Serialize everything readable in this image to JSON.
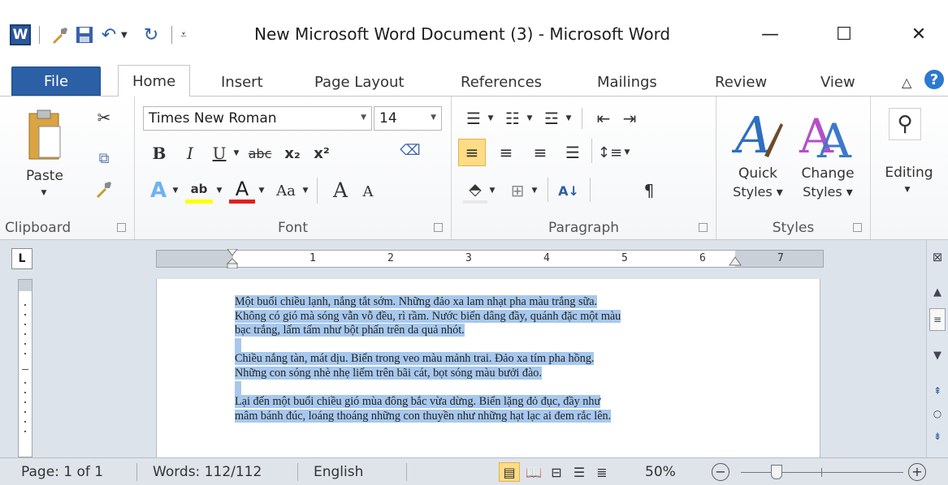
{
  "window": {
    "title": "New Microsoft Word Document (3)  -  Microsoft Word",
    "app_logo": "W",
    "minimize_icon": "—",
    "maximize_icon": "☐",
    "close_icon": "✕"
  },
  "qat": {
    "icons": [
      "brush-icon",
      "save-icon",
      "undo-icon",
      "redo-icon",
      "customize-icon"
    ]
  },
  "tabs": [
    "File",
    "Home",
    "Insert",
    "Page Layout",
    "References",
    "Mailings",
    "Review",
    "View"
  ],
  "ribbon": {
    "clipboard": {
      "label": "Clipboard",
      "paste_label": "Paste"
    },
    "font": {
      "label": "Font",
      "font_name": "Times New Roman",
      "font_size": "14",
      "bold": "B",
      "italic": "I",
      "underline": "U",
      "strike": "abc",
      "subscript": "x₂",
      "superscript": "x²",
      "change_case": "Aa",
      "grow": "A",
      "shrink": "A",
      "font_color": "A",
      "highlight": "ab"
    },
    "paragraph": {
      "label": "Paragraph",
      "pilcrow": "¶",
      "sort": "A↓"
    },
    "styles": {
      "label": "Styles",
      "quick_styles_line1": "Quick",
      "quick_styles_line2": "Styles ▾",
      "change_styles_line1": "Change",
      "change_styles_line2": "Styles ▾"
    },
    "editing": {
      "label": "Editing"
    }
  },
  "ruler": {
    "numbers": [
      "1",
      "2",
      "3",
      "4",
      "5",
      "6",
      "7"
    ]
  },
  "document": {
    "paragraphs": [
      [
        "Một buổi chiều lạnh, nắng tắt sớm. Những đảo xa lam nhạt pha màu trắng sữa.",
        "Không có gió mà sóng vẫn vỗ đều, rì rầm. Nước biển dâng đầy, quánh đặc một màu",
        "bạc trắng, lấm tấm như bột phấn trên da quả nhót."
      ],
      [
        "Chiều nắng tàn, mát dịu. Biển trong veo màu mảnh trai. Đảo xa tím pha hồng.",
        "Những con sóng nhè nhẹ liếm trên bãi cát, bọt sóng màu bưởi đào."
      ],
      [
        "Lại đến một buổi chiều gió mùa đông bắc vừa dừng. Biển lặng đỏ đục, đầy như",
        "mâm bánh đúc, loáng thoáng những con thuyền như những hạt lạc ai đem rắc lên."
      ]
    ]
  },
  "status": {
    "page": "Page: 1 of 1",
    "words": "Words: 112/112",
    "language": "English",
    "zoom": "50%",
    "zoom_level_percent": 50,
    "zoom_out": "−",
    "zoom_in": "+"
  },
  "colors": {
    "accent": "#2b579a",
    "selection": "#a7c8ee",
    "active_button": "#fddc85"
  }
}
